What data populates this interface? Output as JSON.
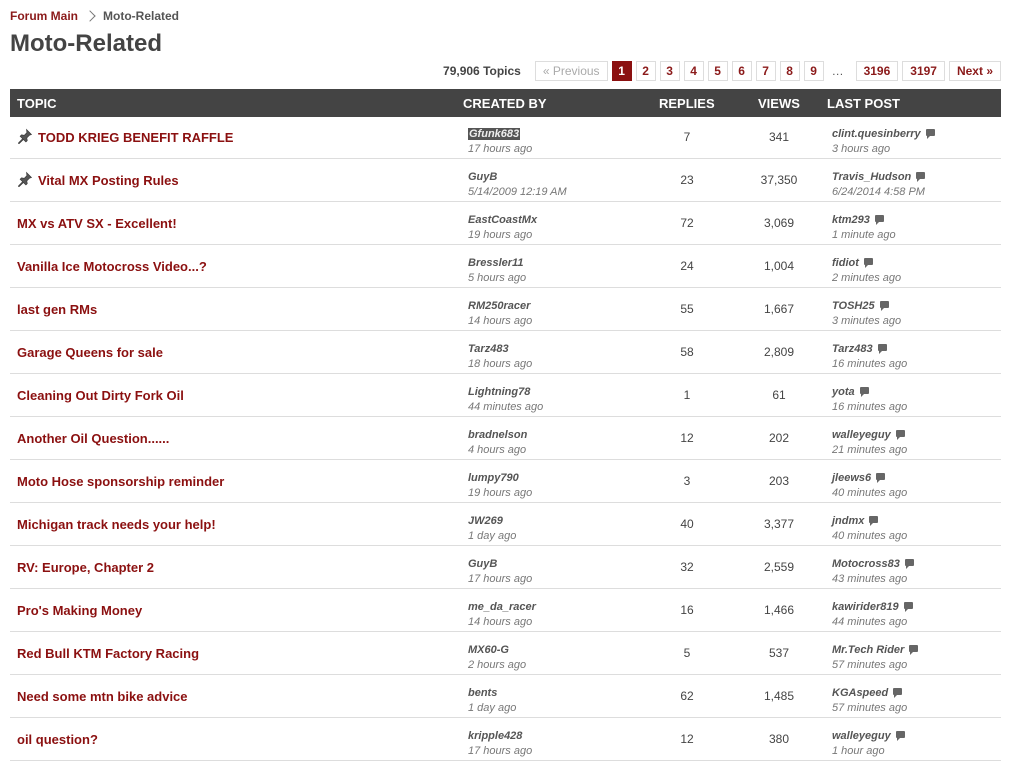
{
  "breadcrumb": {
    "root": "Forum Main",
    "current": "Moto-Related"
  },
  "page_title": "Moto-Related",
  "pager": {
    "topic_count": "79,906 Topics",
    "previous": "« Previous",
    "pages": [
      "1",
      "2",
      "3",
      "4",
      "5",
      "6",
      "7",
      "8",
      "9"
    ],
    "ellipsis": "…",
    "last_pages": [
      "3196",
      "3197"
    ],
    "next": "Next »"
  },
  "table": {
    "headers": {
      "topic": "TOPIC",
      "created_by": "CREATED BY",
      "replies": "REPLIES",
      "views": "VIEWS",
      "last_post": "LAST POST"
    },
    "rows": [
      {
        "topic": "TODD KRIEG BENEFIT RAFFLE",
        "pinned": true,
        "creator": "Gfunk683",
        "created": "17 hours ago",
        "replies": "7",
        "views": "341",
        "last_user": "clint.quesinberry",
        "last_time": "3 hours ago"
      },
      {
        "topic": "Vital MX Posting Rules",
        "pinned": true,
        "creator": "GuyB",
        "created": "5/14/2009 12:19 AM",
        "replies": "23",
        "views": "37,350",
        "last_user": "Travis_Hudson",
        "last_time": "6/24/2014 4:58 PM"
      },
      {
        "topic": "MX vs ATV SX - Excellent!",
        "pinned": false,
        "creator": "EastCoastMx",
        "created": "19 hours ago",
        "replies": "72",
        "views": "3,069",
        "last_user": "ktm293",
        "last_time": "1 minute ago"
      },
      {
        "topic": "Vanilla Ice Motocross Video...?",
        "pinned": false,
        "creator": "Bressler11",
        "created": "5 hours ago",
        "replies": "24",
        "views": "1,004",
        "last_user": "fidiot",
        "last_time": "2 minutes ago"
      },
      {
        "topic": "last gen RMs",
        "pinned": false,
        "creator": "RM250racer",
        "created": "14 hours ago",
        "replies": "55",
        "views": "1,667",
        "last_user": "TOSH25",
        "last_time": "3 minutes ago"
      },
      {
        "topic": "Garage Queens for sale",
        "pinned": false,
        "creator": "Tarz483",
        "created": "18 hours ago",
        "replies": "58",
        "views": "2,809",
        "last_user": "Tarz483",
        "last_time": "16 minutes ago"
      },
      {
        "topic": "Cleaning Out Dirty Fork Oil",
        "pinned": false,
        "creator": "Lightning78",
        "created": "44 minutes ago",
        "replies": "1",
        "views": "61",
        "last_user": "yota",
        "last_time": "16 minutes ago"
      },
      {
        "topic": "Another Oil Question......",
        "pinned": false,
        "creator": "bradnelson",
        "created": "4 hours ago",
        "replies": "12",
        "views": "202",
        "last_user": "walleyeguy",
        "last_time": "21 minutes ago"
      },
      {
        "topic": "Moto Hose sponsorship reminder",
        "pinned": false,
        "creator": "lumpy790",
        "created": "19 hours ago",
        "replies": "3",
        "views": "203",
        "last_user": "jleews6",
        "last_time": "40 minutes ago"
      },
      {
        "topic": "Michigan track needs your help!",
        "pinned": false,
        "creator": "JW269",
        "created": "1 day ago",
        "replies": "40",
        "views": "3,377",
        "last_user": "jndmx",
        "last_time": "40 minutes ago"
      },
      {
        "topic": "RV: Europe, Chapter 2",
        "pinned": false,
        "creator": "GuyB",
        "created": "17 hours ago",
        "replies": "32",
        "views": "2,559",
        "last_user": "Motocross83",
        "last_time": "43 minutes ago"
      },
      {
        "topic": "Pro's Making Money",
        "pinned": false,
        "creator": "me_da_racer",
        "created": "14 hours ago",
        "replies": "16",
        "views": "1,466",
        "last_user": "kawirider819",
        "last_time": "44 minutes ago"
      },
      {
        "topic": "Red Bull KTM Factory Racing",
        "pinned": false,
        "creator": "MX60-G",
        "created": "2 hours ago",
        "replies": "5",
        "views": "537",
        "last_user": "Mr.Tech Rider",
        "last_time": "57 minutes ago"
      },
      {
        "topic": "Need some mtn bike advice",
        "pinned": false,
        "creator": "bents",
        "created": "1 day ago",
        "replies": "62",
        "views": "1,485",
        "last_user": "KGAspeed",
        "last_time": "57 minutes ago"
      },
      {
        "topic": "oil question?",
        "pinned": false,
        "creator": "kripple428",
        "created": "17 hours ago",
        "replies": "12",
        "views": "380",
        "last_user": "walleyeguy",
        "last_time": "1 hour ago"
      }
    ]
  }
}
